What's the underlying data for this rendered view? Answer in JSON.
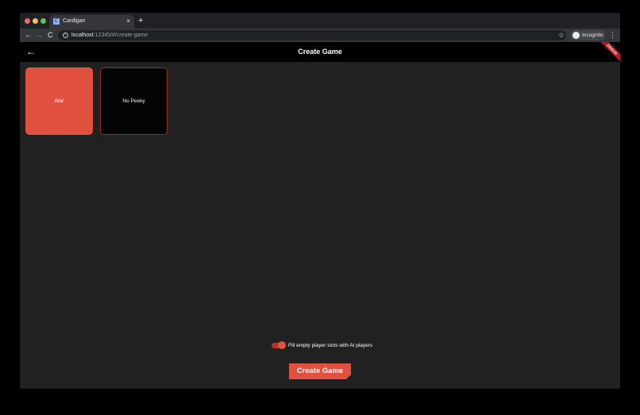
{
  "browser": {
    "tab_title": "Cardigan",
    "tab_favicon": "C",
    "tab_close": "×",
    "new_tab": "+",
    "url_host": "localhost",
    "url_path": ":12345/#/create-game",
    "incognito_label": "Incognito",
    "icons": {
      "back": "←",
      "forward": "→",
      "reload": "C",
      "info": "i",
      "star": "☆",
      "menu": "⋮"
    }
  },
  "app": {
    "back_icon": "←",
    "title": "Create Game",
    "debug_banner": "DEBUG",
    "games": [
      {
        "label": "War",
        "selected": true
      },
      {
        "label": "No Peeky",
        "selected": false
      }
    ],
    "fill_ai_toggle": {
      "label": "Fill empty player slots with AI players",
      "on": true
    },
    "create_button_label": "Create Game"
  },
  "colors": {
    "accent": "#e05140",
    "background": "#212121",
    "appbar": "#000000"
  }
}
